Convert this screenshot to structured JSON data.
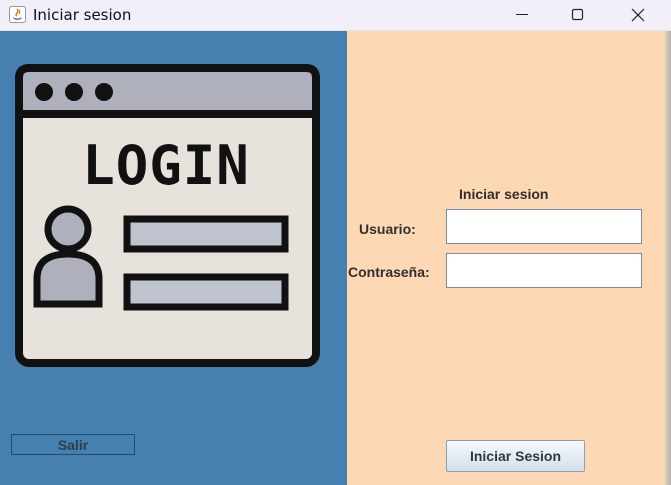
{
  "window": {
    "title": "Iniciar sesion",
    "controls": [
      "minimize-icon",
      "maximize-icon",
      "close-icon"
    ]
  },
  "left_panel": {
    "image_text": "LOGIN",
    "exit_label": "Salir",
    "background": "#4580b0"
  },
  "form": {
    "heading": "Iniciar sesion",
    "user_label": "Usuario:",
    "user_value": "",
    "password_label": "Contraseña:",
    "password_value": "",
    "submit_label": "Iniciar Sesion",
    "background": "#fdd8b5"
  }
}
